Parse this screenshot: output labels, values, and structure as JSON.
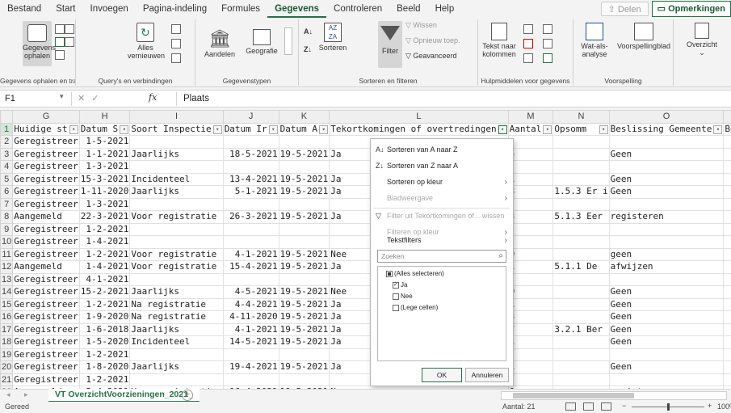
{
  "ribbon_tabs": [
    "Bestand",
    "Start",
    "Invoegen",
    "Pagina-indeling",
    "Formules",
    "Gegevens",
    "Controleren",
    "Beeld",
    "Help"
  ],
  "active_tab": "Gegevens",
  "share_label": "Delen",
  "comments_label": "Opmerkingen",
  "ribbon": {
    "get_data": "Gegevens ophalen",
    "get_group": "Gegevens ophalen en transforme...",
    "refresh": "Alles vernieuwen",
    "query_group": "Query's en verbindingen",
    "stocks": "Aandelen",
    "geography": "Geografie",
    "datatypes_group": "Gegevenstypen",
    "sort": "Sorteren",
    "filter": "Filter",
    "clear": "Wissen",
    "reapply": "Opnieuw toep.",
    "advanced": "Geavanceerd",
    "sortfilter_group": "Sorteren en filteren",
    "text_to_columns": "Tekst naar kolommen",
    "datatools_group": "Hulpmiddelen voor gegevens",
    "whatif": "Wat-als-analyse",
    "forecast": "Voorspellingblad",
    "forecast_group": "Voorspelling",
    "outline": "Overzicht"
  },
  "formula_bar": {
    "namebox": "F1",
    "fx": "fx",
    "value": "Plaats"
  },
  "columns": [
    "G",
    "H",
    "I",
    "J",
    "K",
    "L",
    "M",
    "N",
    "O"
  ],
  "header_row": [
    "Huidige st",
    "Datum S",
    "Soort Inspectie",
    "Datum Ir",
    "Datum A",
    "Tekortkomingen of overtredingen",
    "Aantal",
    "Opsomm",
    "Beslissing Gemeente",
    "Beha"
  ],
  "rows": [
    {
      "n": "2",
      "g": "Geregistreer",
      "h": "1-5-2021",
      "i": "",
      "j": "",
      "k": "",
      "l": "",
      "m": "",
      "n2": "",
      "o": ""
    },
    {
      "n": "3",
      "g": "Geregistreer",
      "h": "1-1-2021",
      "i": "Jaarlijks",
      "j": "18-5-2021",
      "k": "19-5-2021",
      "l": "Ja",
      "m": "5",
      "n2": "",
      "o": "Geen"
    },
    {
      "n": "4",
      "g": "Geregistreer",
      "h": "1-3-2021",
      "i": "",
      "j": "",
      "k": "",
      "l": "",
      "m": "",
      "n2": "",
      "o": ""
    },
    {
      "n": "5",
      "g": "Geregistreer",
      "h": "15-3-2021",
      "i": "Incidenteel",
      "j": "13-4-2021",
      "k": "19-5-2021",
      "l": "Ja",
      "m": "1",
      "n2": "",
      "o": "Geen"
    },
    {
      "n": "6",
      "g": "Geregistreer",
      "h": "1-11-2020",
      "i": "Jaarlijks",
      "j": "5-1-2021",
      "k": "19-5-2021",
      "l": "Ja",
      "m": "3",
      "n2": "1.5.3   Er i",
      "o": "Geen"
    },
    {
      "n": "7",
      "g": "Geregistreer",
      "h": "1-3-2021",
      "i": "",
      "j": "",
      "k": "",
      "l": "",
      "m": "",
      "n2": "",
      "o": ""
    },
    {
      "n": "8",
      "g": "Aangemeld",
      "h": "22-3-2021",
      "i": "Voor registratie",
      "j": "26-3-2021",
      "k": "19-5-2021",
      "l": "Ja",
      "m": "3",
      "n2": "5.1.3   Eer",
      "o": "registeren"
    },
    {
      "n": "9",
      "g": "Geregistreer",
      "h": "1-2-2021",
      "i": "",
      "j": "",
      "k": "",
      "l": "",
      "m": "",
      "n2": "",
      "o": ""
    },
    {
      "n": "10",
      "g": "Geregistreer",
      "h": "1-4-2021",
      "i": "",
      "j": "",
      "k": "",
      "l": "",
      "m": "",
      "n2": "",
      "o": ""
    },
    {
      "n": "11",
      "g": "Geregistreer",
      "h": "1-2-2021",
      "i": "Voor registratie",
      "j": "4-1-2021",
      "k": "19-5-2021",
      "l": "Nee",
      "m": "0",
      "n2": "",
      "o": "geen"
    },
    {
      "n": "12",
      "g": "Aangemeld",
      "h": "1-4-2021",
      "i": "Voor registratie",
      "j": "15-4-2021",
      "k": "19-5-2021",
      "l": "Ja",
      "m": "1",
      "n2": "5.1.1   De",
      "o": "afwijzen"
    },
    {
      "n": "13",
      "g": "Geregistreer",
      "h": "4-1-2021",
      "i": "",
      "j": "",
      "k": "",
      "l": "",
      "m": "",
      "n2": "",
      "o": ""
    },
    {
      "n": "14",
      "g": "Geregistreer",
      "h": "15-2-2021",
      "i": "Jaarlijks",
      "j": "4-5-2021",
      "k": "19-5-2021",
      "l": "Nee",
      "m": "0",
      "n2": "",
      "o": "Geen"
    },
    {
      "n": "15",
      "g": "Geregistreer",
      "h": "1-2-2021",
      "i": "Na registratie",
      "j": "4-4-2021",
      "k": "19-5-2021",
      "l": "Ja",
      "m": "1",
      "n2": "",
      "o": "Geen"
    },
    {
      "n": "16",
      "g": "Geregistreer",
      "h": "1-9-2020",
      "i": "Na registratie",
      "j": "4-11-2020",
      "k": "19-5-2021",
      "l": "Ja",
      "m": "3",
      "n2": "",
      "o": "Geen"
    },
    {
      "n": "17",
      "g": "Geregistreer",
      "h": "1-6-2018",
      "i": "Jaarlijks",
      "j": "4-1-2021",
      "k": "19-5-2021",
      "l": "Ja",
      "m": "7",
      "n2": "3.2.1   Ber",
      "o": "Geen"
    },
    {
      "n": "18",
      "g": "Geregistreer",
      "h": "1-5-2020",
      "i": "Incidenteel",
      "j": "14-5-2021",
      "k": "19-5-2021",
      "l": "Ja",
      "m": "1",
      "n2": "",
      "o": "Geen"
    },
    {
      "n": "19",
      "g": "Geregistreer",
      "h": "1-2-2021",
      "i": "",
      "j": "",
      "k": "",
      "l": "",
      "m": "",
      "n2": "",
      "o": ""
    },
    {
      "n": "20",
      "g": "Geregistreer",
      "h": "1-8-2020",
      "i": "Jaarlijks",
      "j": "19-4-2021",
      "k": "19-5-2021",
      "l": "Ja",
      "m": "1",
      "n2": "",
      "o": "Geen"
    },
    {
      "n": "21",
      "g": "Geregistreer",
      "h": "1-2-2021",
      "i": "",
      "j": "",
      "k": "",
      "l": "",
      "m": "",
      "n2": "",
      "o": ""
    },
    {
      "n": "22",
      "g": "Aangemeld",
      "h": "5-4-2021",
      "i": "Voor registratie",
      "j": "16-4-2021",
      "k": "19-5-2021",
      "l": "Nee",
      "m": "0",
      "n2": "",
      "o": "registeren"
    }
  ],
  "dropdown": {
    "sort_az": "Sorteren van A naar Z",
    "sort_za": "Sorteren van Z naar A",
    "sort_color": "Sorteren op kleur",
    "sheet_view": "Bladweergave",
    "clear_filter": "Filter uit Tekortkomingen of... wissen",
    "filter_color": "Filteren op kleur",
    "text_filters": "Tekstfilters",
    "search_placeholder": "Zoeken",
    "options": [
      {
        "label": "(Alles selecteren)",
        "state": "partial"
      },
      {
        "label": "Ja",
        "state": "checked"
      },
      {
        "label": "Nee",
        "state": "unchecked"
      },
      {
        "label": "(Lege cellen)",
        "state": "unchecked"
      }
    ],
    "ok": "OK",
    "cancel": "Annuleren"
  },
  "sheet_tab": "VT OverzichtVoorzieningen_2021_",
  "status": {
    "text": "Gereed",
    "count": "Aantal: 21",
    "zoom": "100%"
  },
  "colors": {
    "accent": "#217346",
    "header_bg": "#efefef"
  }
}
